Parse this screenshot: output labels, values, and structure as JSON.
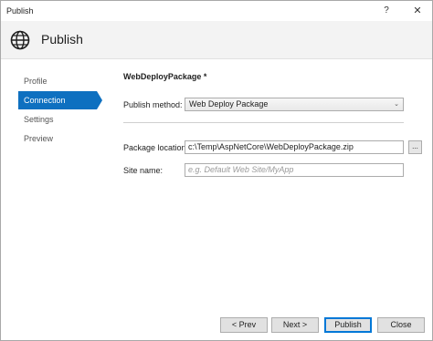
{
  "window": {
    "title": "Publish",
    "help_glyph": "?",
    "close_glyph": "✕"
  },
  "header": {
    "icon": "globe-icon",
    "title": "Publish"
  },
  "nav": {
    "items": [
      {
        "label": "Profile",
        "active": false
      },
      {
        "label": "Connection",
        "active": true
      },
      {
        "label": "Settings",
        "active": false
      },
      {
        "label": "Preview",
        "active": false
      }
    ]
  },
  "form": {
    "section_title": "WebDeployPackage *",
    "publish_method": {
      "label": "Publish method:",
      "value": "Web Deploy Package",
      "arrow": "⌄"
    },
    "package_location": {
      "label": "Package location:",
      "value": "c:\\Temp\\AspNetCore\\WebDeployPackage.zip",
      "browse_label": "..."
    },
    "site_name": {
      "label": "Site name:",
      "value": "",
      "placeholder": "e.g. Default Web Site/MyApp"
    }
  },
  "buttons": {
    "prev": "< Prev",
    "next": "Next >",
    "publish": "Publish",
    "close": "Close"
  },
  "colors": {
    "accent": "#0e70c0",
    "header_bg": "#f3f3f3",
    "button_bg": "#e1e1e1"
  }
}
